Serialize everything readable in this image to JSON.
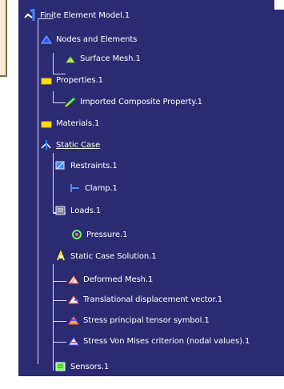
{
  "tree": {
    "root": "Finite Element Model.1",
    "nodes_elements": "Nodes and Elements",
    "surface_mesh": "Surface Mesh.1",
    "properties": "Properties.1",
    "imported_composite": "Imported Composite Property.1",
    "materials": "Materials.1",
    "static_case": "Static Case",
    "restraints": "Restraints.1",
    "clamp": "Clamp.1",
    "loads": "Loads.1",
    "pressure": "Pressure.1",
    "static_solution": "Static Case Solution.1",
    "deformed_mesh": "Deformed Mesh.1",
    "translational": "Translational displacement vector.1",
    "stress_principal": "Stress principal tensor symbol.1",
    "stress_von_mises": "Stress Von Mises criterion (nodal values).1",
    "sensors": "Sensors.1"
  }
}
